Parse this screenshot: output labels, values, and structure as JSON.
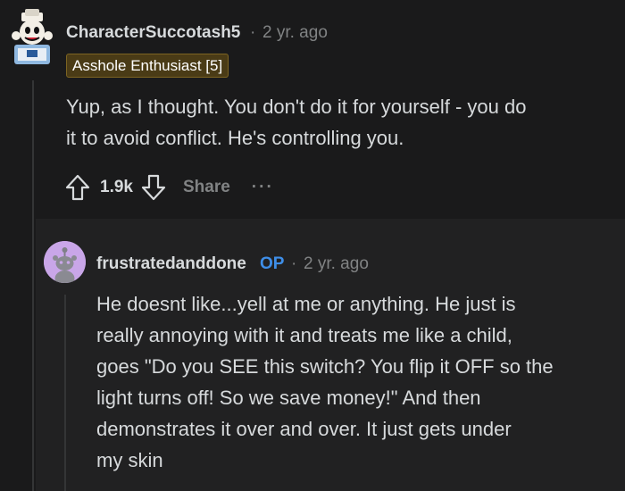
{
  "comments": [
    {
      "username": "CharacterSuccotash5",
      "separator": "·",
      "time": "2 yr. ago",
      "flair": "Asshole Enthusiast [5]",
      "body_lines": [
        "Yup, as I thought. You don't do it for yourself - you do",
        "it to avoid conflict. He's controlling you."
      ],
      "score": "1.9k",
      "share_label": "Share",
      "more_label": "···"
    },
    {
      "username": "frustratedanddone",
      "op_tag": "OP",
      "separator": "·",
      "time": "2 yr. ago",
      "body_lines": [
        "He doesnt like...yell at me or anything. He just is",
        "really annoying with it and treats me like a child,",
        "goes \"Do you SEE this switch? You flip it OFF so the",
        "light turns off! So we save money!\" And then",
        "demonstrates it over and over. It just gets under",
        "my skin"
      ]
    }
  ],
  "colors": {
    "background": "#1a1a1b",
    "reply_background": "#212122",
    "op_tag": "#3e8ee8",
    "flair_background": "#4a3b16"
  }
}
